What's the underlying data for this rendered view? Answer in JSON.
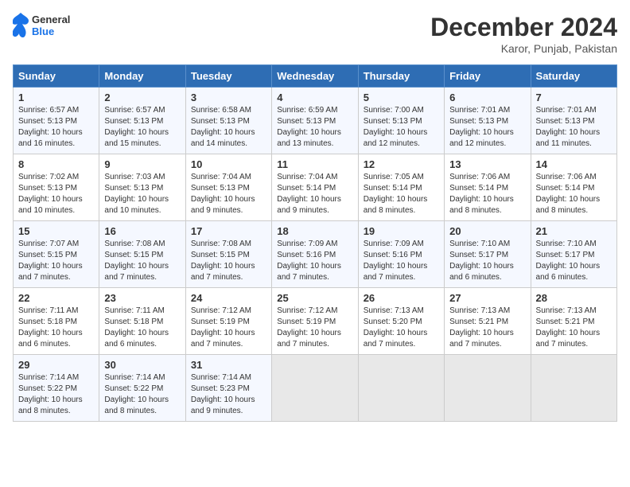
{
  "header": {
    "logo_line1": "General",
    "logo_line2": "Blue",
    "month": "December 2024",
    "location": "Karor, Punjab, Pakistan"
  },
  "days_of_week": [
    "Sunday",
    "Monday",
    "Tuesday",
    "Wednesday",
    "Thursday",
    "Friday",
    "Saturday"
  ],
  "weeks": [
    [
      {
        "day": "1",
        "detail": "Sunrise: 6:57 AM\nSunset: 5:13 PM\nDaylight: 10 hours\nand 16 minutes."
      },
      {
        "day": "2",
        "detail": "Sunrise: 6:57 AM\nSunset: 5:13 PM\nDaylight: 10 hours\nand 15 minutes."
      },
      {
        "day": "3",
        "detail": "Sunrise: 6:58 AM\nSunset: 5:13 PM\nDaylight: 10 hours\nand 14 minutes."
      },
      {
        "day": "4",
        "detail": "Sunrise: 6:59 AM\nSunset: 5:13 PM\nDaylight: 10 hours\nand 13 minutes."
      },
      {
        "day": "5",
        "detail": "Sunrise: 7:00 AM\nSunset: 5:13 PM\nDaylight: 10 hours\nand 12 minutes."
      },
      {
        "day": "6",
        "detail": "Sunrise: 7:01 AM\nSunset: 5:13 PM\nDaylight: 10 hours\nand 12 minutes."
      },
      {
        "day": "7",
        "detail": "Sunrise: 7:01 AM\nSunset: 5:13 PM\nDaylight: 10 hours\nand 11 minutes."
      }
    ],
    [
      {
        "day": "8",
        "detail": "Sunrise: 7:02 AM\nSunset: 5:13 PM\nDaylight: 10 hours\nand 10 minutes."
      },
      {
        "day": "9",
        "detail": "Sunrise: 7:03 AM\nSunset: 5:13 PM\nDaylight: 10 hours\nand 10 minutes."
      },
      {
        "day": "10",
        "detail": "Sunrise: 7:04 AM\nSunset: 5:13 PM\nDaylight: 10 hours\nand 9 minutes."
      },
      {
        "day": "11",
        "detail": "Sunrise: 7:04 AM\nSunset: 5:14 PM\nDaylight: 10 hours\nand 9 minutes."
      },
      {
        "day": "12",
        "detail": "Sunrise: 7:05 AM\nSunset: 5:14 PM\nDaylight: 10 hours\nand 8 minutes."
      },
      {
        "day": "13",
        "detail": "Sunrise: 7:06 AM\nSunset: 5:14 PM\nDaylight: 10 hours\nand 8 minutes."
      },
      {
        "day": "14",
        "detail": "Sunrise: 7:06 AM\nSunset: 5:14 PM\nDaylight: 10 hours\nand 8 minutes."
      }
    ],
    [
      {
        "day": "15",
        "detail": "Sunrise: 7:07 AM\nSunset: 5:15 PM\nDaylight: 10 hours\nand 7 minutes."
      },
      {
        "day": "16",
        "detail": "Sunrise: 7:08 AM\nSunset: 5:15 PM\nDaylight: 10 hours\nand 7 minutes."
      },
      {
        "day": "17",
        "detail": "Sunrise: 7:08 AM\nSunset: 5:15 PM\nDaylight: 10 hours\nand 7 minutes."
      },
      {
        "day": "18",
        "detail": "Sunrise: 7:09 AM\nSunset: 5:16 PM\nDaylight: 10 hours\nand 7 minutes."
      },
      {
        "day": "19",
        "detail": "Sunrise: 7:09 AM\nSunset: 5:16 PM\nDaylight: 10 hours\nand 7 minutes."
      },
      {
        "day": "20",
        "detail": "Sunrise: 7:10 AM\nSunset: 5:17 PM\nDaylight: 10 hours\nand 6 minutes."
      },
      {
        "day": "21",
        "detail": "Sunrise: 7:10 AM\nSunset: 5:17 PM\nDaylight: 10 hours\nand 6 minutes."
      }
    ],
    [
      {
        "day": "22",
        "detail": "Sunrise: 7:11 AM\nSunset: 5:18 PM\nDaylight: 10 hours\nand 6 minutes."
      },
      {
        "day": "23",
        "detail": "Sunrise: 7:11 AM\nSunset: 5:18 PM\nDaylight: 10 hours\nand 6 minutes."
      },
      {
        "day": "24",
        "detail": "Sunrise: 7:12 AM\nSunset: 5:19 PM\nDaylight: 10 hours\nand 7 minutes."
      },
      {
        "day": "25",
        "detail": "Sunrise: 7:12 AM\nSunset: 5:19 PM\nDaylight: 10 hours\nand 7 minutes."
      },
      {
        "day": "26",
        "detail": "Sunrise: 7:13 AM\nSunset: 5:20 PM\nDaylight: 10 hours\nand 7 minutes."
      },
      {
        "day": "27",
        "detail": "Sunrise: 7:13 AM\nSunset: 5:21 PM\nDaylight: 10 hours\nand 7 minutes."
      },
      {
        "day": "28",
        "detail": "Sunrise: 7:13 AM\nSunset: 5:21 PM\nDaylight: 10 hours\nand 7 minutes."
      }
    ],
    [
      {
        "day": "29",
        "detail": "Sunrise: 7:14 AM\nSunset: 5:22 PM\nDaylight: 10 hours\nand 8 minutes."
      },
      {
        "day": "30",
        "detail": "Sunrise: 7:14 AM\nSunset: 5:22 PM\nDaylight: 10 hours\nand 8 minutes."
      },
      {
        "day": "31",
        "detail": "Sunrise: 7:14 AM\nSunset: 5:23 PM\nDaylight: 10 hours\nand 9 minutes."
      },
      {
        "day": "",
        "detail": ""
      },
      {
        "day": "",
        "detail": ""
      },
      {
        "day": "",
        "detail": ""
      },
      {
        "day": "",
        "detail": ""
      }
    ]
  ]
}
